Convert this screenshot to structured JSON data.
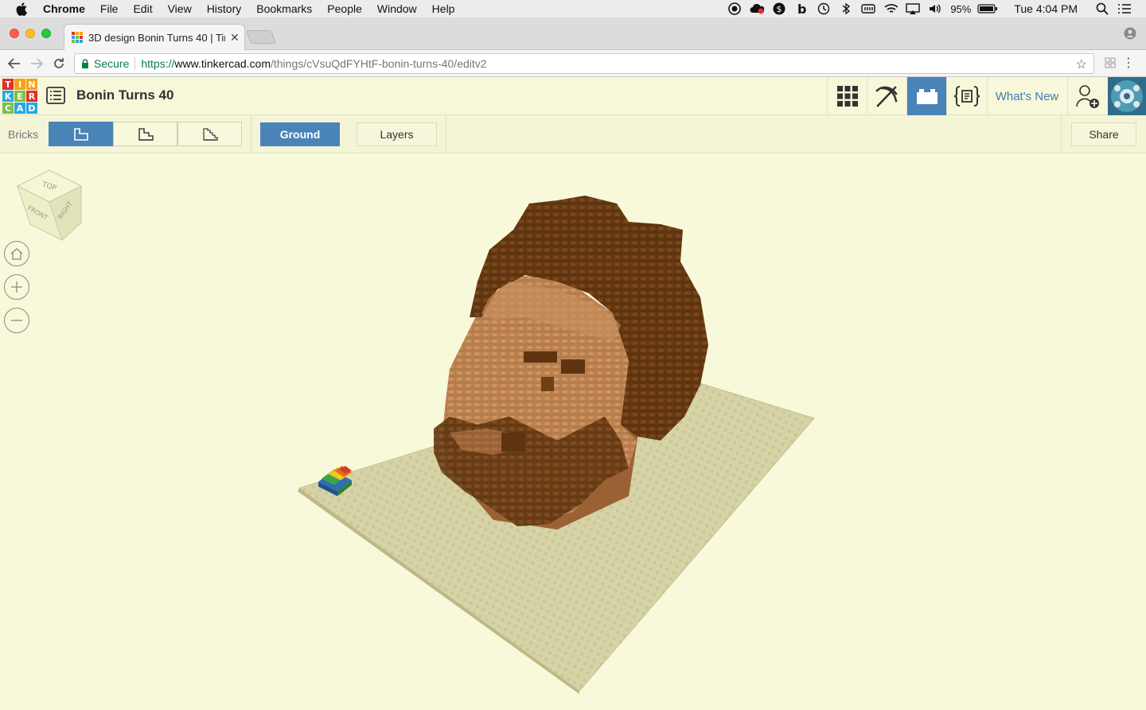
{
  "menubar": {
    "app": "Chrome",
    "items": [
      "File",
      "Edit",
      "View",
      "History",
      "Bookmarks",
      "People",
      "Window",
      "Help"
    ],
    "battery": "95%",
    "clock": "Tue 4:04 PM"
  },
  "browser": {
    "tab_title": "3D design Bonin Turns 40 | Tin",
    "url_secure_label": "Secure",
    "url_scheme": "https://",
    "url_host": "www.tinkercad.com",
    "url_path": "/things/cVsuQdFYHtF-bonin-turns-40/editv2"
  },
  "app": {
    "logo_letters": [
      "T",
      "I",
      "N",
      "K",
      "E",
      "R",
      "C",
      "A",
      "D"
    ],
    "logo_colors": [
      "#e1312d",
      "#f6a21a",
      "#f6a21a",
      "#2aa7e1",
      "#7bc143",
      "#e1312d",
      "#7bc143",
      "#2aa7e1",
      "#2aa7e1"
    ],
    "design_title": "Bonin Turns 40",
    "whats_new": "What's New",
    "accent_color": "#4a83b7"
  },
  "subbar": {
    "bricks_label": "Bricks",
    "ground_label": "Ground",
    "layers_label": "Layers",
    "share_label": "Share"
  },
  "viewcube": {
    "top": "TOP",
    "front": "FRONT",
    "right": "RIGHT"
  }
}
